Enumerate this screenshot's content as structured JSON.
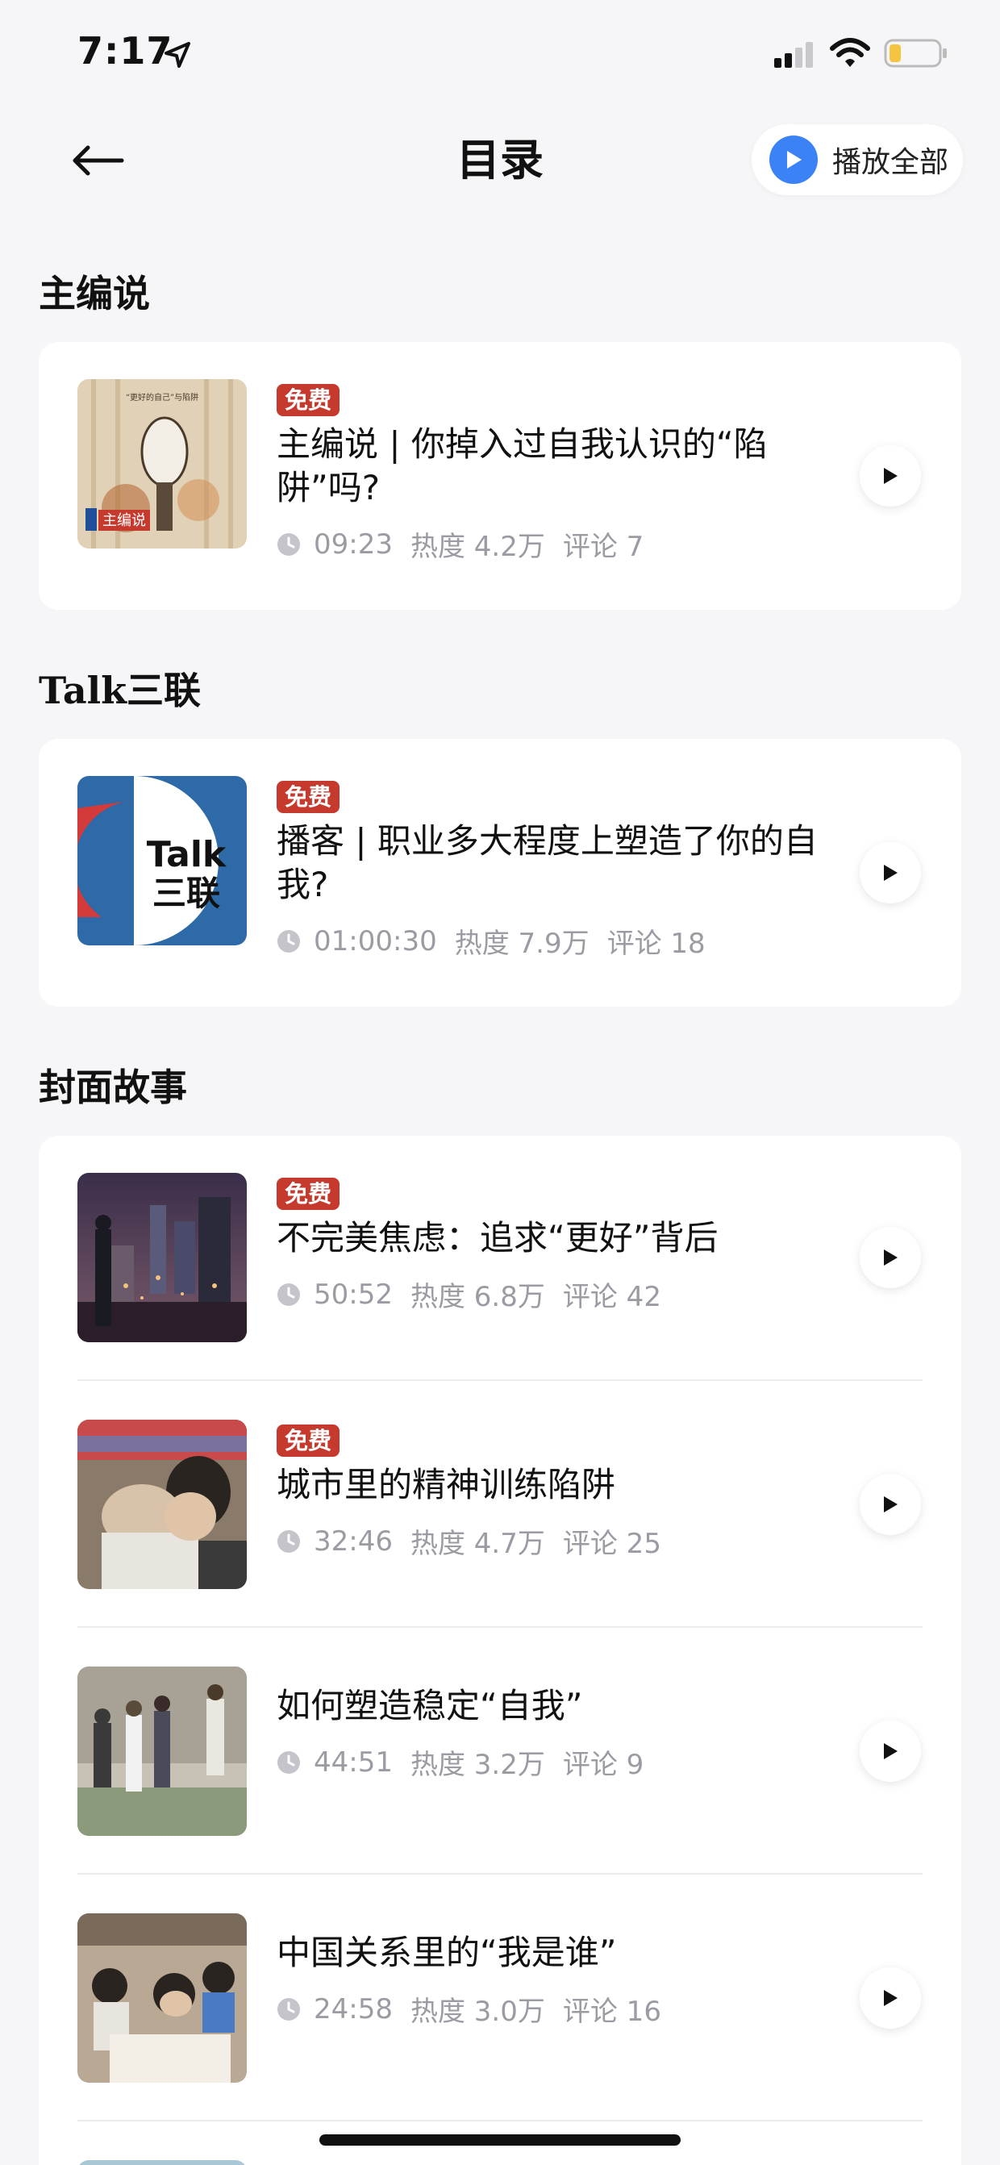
{
  "status_bar": {
    "time": "7:17"
  },
  "header": {
    "title": "目录",
    "play_all_label": "播放全部"
  },
  "sections": [
    {
      "title": "主编说",
      "items": [
        {
          "badge": "免费",
          "title": "主编说 | 你掉入过自我认识的“陷阱”吗?",
          "duration": "09:23",
          "heat": "热度 4.2万",
          "comments": "评论 7",
          "thumb_text_top": "“更好的自己”与陷阱",
          "thumb_text_label": "主编说"
        }
      ]
    },
    {
      "title": "Talk三联",
      "items": [
        {
          "badge": "免费",
          "title": "播客 | 职业多大程度上塑造了你的自我?",
          "duration": "01:00:30",
          "heat": "热度 7.9万",
          "comments": "评论 18",
          "thumb_logo_top": "Talk",
          "thumb_logo_bottom": "三联"
        }
      ]
    },
    {
      "title": "封面故事",
      "items": [
        {
          "badge": "免费",
          "title": "不完美焦虑：追求“更好”背后",
          "duration": "50:52",
          "heat": "热度 6.8万",
          "comments": "评论 42"
        },
        {
          "badge": "免费",
          "title": "城市里的精神训练陷阱",
          "duration": "32:46",
          "heat": "热度 4.7万",
          "comments": "评论 25"
        },
        {
          "badge": "",
          "title": "如何塑造稳定“自我”",
          "duration": "44:51",
          "heat": "热度 3.2万",
          "comments": "评论 9"
        },
        {
          "badge": "",
          "title": "中国关系里的“我是谁”",
          "duration": "24:58",
          "heat": "热度 3.0万",
          "comments": "评论 16"
        }
      ]
    }
  ],
  "colors": {
    "badge": "#c63a2e",
    "accent": "#3b82f6",
    "meta": "#9b9ba3",
    "background": "#f6f6f8"
  }
}
